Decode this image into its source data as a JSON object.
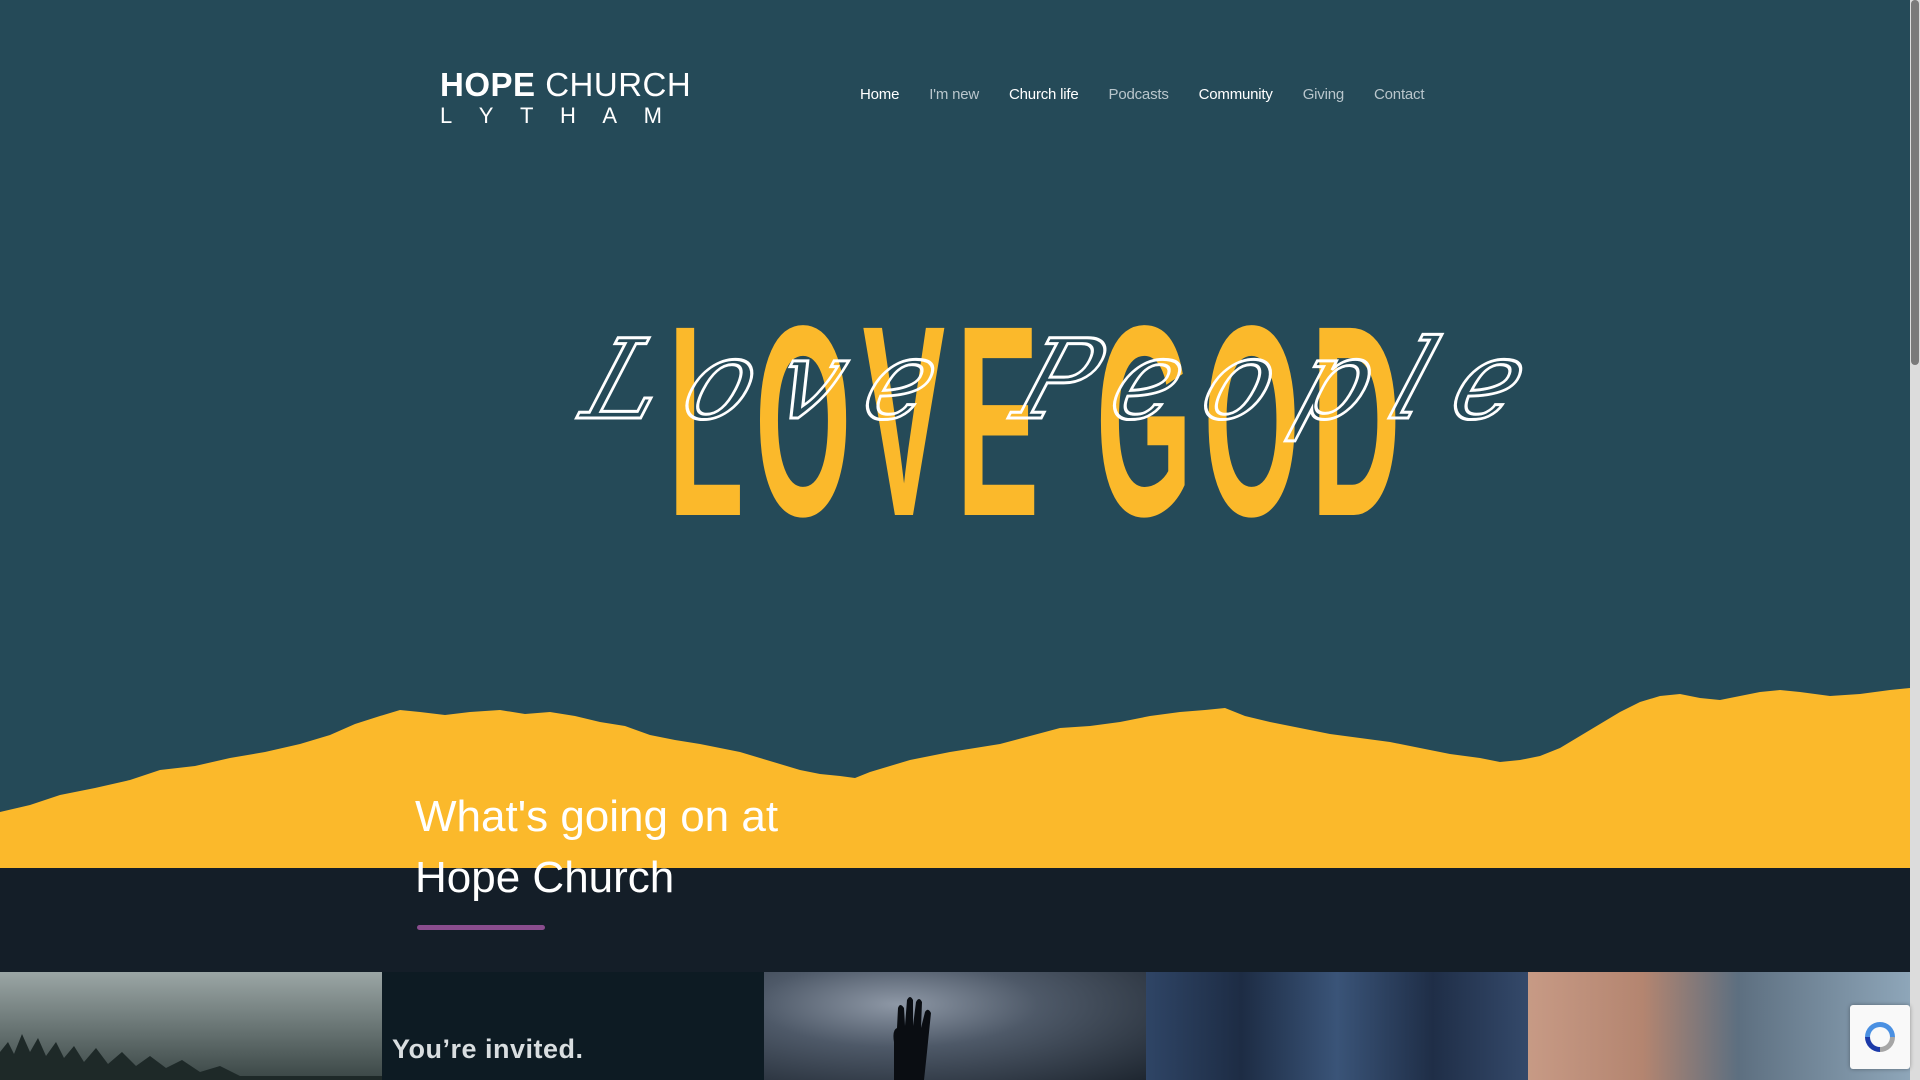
{
  "brand": {
    "name_bold": "HOPE",
    "name_light": "CHURCH",
    "location_letters": [
      "L",
      "Y",
      "T",
      "H",
      "A",
      "M"
    ]
  },
  "nav": {
    "items": [
      {
        "label": "Home",
        "active": true
      },
      {
        "label": "I'm new",
        "active": false
      },
      {
        "label": "Church life",
        "active": true
      },
      {
        "label": "Podcasts",
        "active": false
      },
      {
        "label": "Community",
        "active": true
      },
      {
        "label": "Giving",
        "active": false
      },
      {
        "label": "Contact",
        "active": false
      }
    ]
  },
  "hero": {
    "block_text": "LOVE GOD",
    "script_text": "Love People"
  },
  "section": {
    "title": "What's going on at Hope Church"
  },
  "tiles": [
    {
      "name": "forest",
      "text": ""
    },
    {
      "name": "invite",
      "text": "You’re invited."
    },
    {
      "name": "worship",
      "text": ""
    },
    {
      "name": "jeans",
      "text": ""
    },
    {
      "name": "face",
      "text": ""
    }
  ],
  "colors": {
    "background": "#254a58",
    "accent_yellow": "#fbb92b",
    "dark_band": "#141e28",
    "rule_purple": "#8a4d8e",
    "nav_text": "#b9c6cc"
  }
}
